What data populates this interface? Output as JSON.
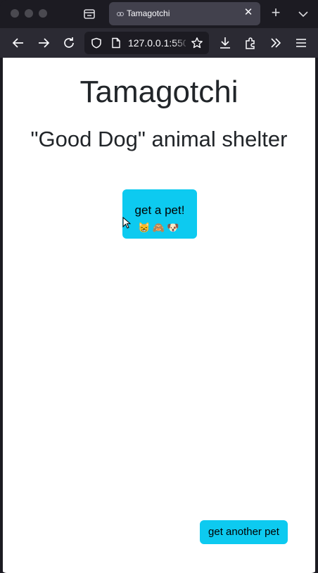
{
  "browser": {
    "tab_title": "Tamagotchi",
    "url": "127.0.0.1:550",
    "icons": {
      "tab_list": "tab-list-icon",
      "close": "close-icon",
      "new_tab": "plus-icon",
      "all_tabs": "chevron-down-icon",
      "back": "arrow-left-icon",
      "forward": "arrow-right-icon",
      "reload": "reload-icon",
      "shield": "shield-icon",
      "page": "page-icon",
      "bookmark": "star-icon",
      "downloads": "download-icon",
      "extensions": "puzzle-icon",
      "overflow": "double-chevron-icon",
      "menu": "hamburger-icon"
    }
  },
  "page": {
    "title": "Tamagotchi",
    "subtitle": "\"Good Dog\" animal shelter",
    "get_pet_label": "get a pet!",
    "get_pet_animals": "😸🙈🐶",
    "another_pet_label": "get another pet",
    "accent_color": "#0dcaf0"
  }
}
